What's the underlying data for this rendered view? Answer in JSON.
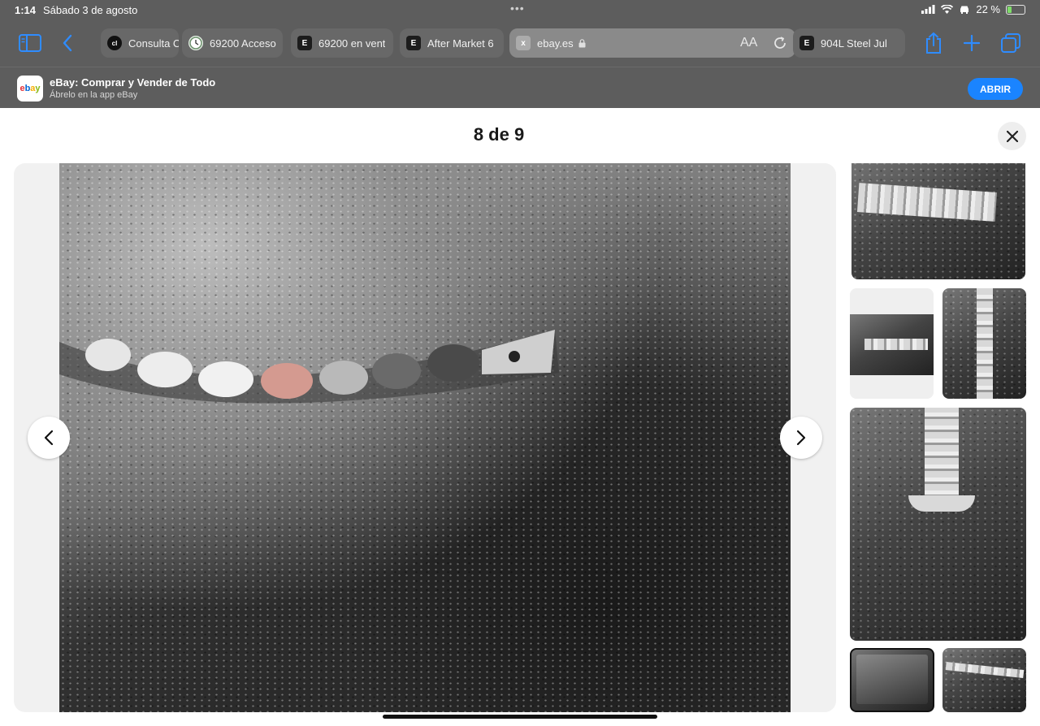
{
  "status_bar": {
    "time": "1:14",
    "date": "Sábado 3 de agosto",
    "battery_text": "22 %",
    "battery_level": 0.22,
    "icons": [
      "cellular-signal-icon",
      "wifi-icon",
      "car-icon",
      "battery-charging-icon"
    ]
  },
  "toolbar": {
    "tabs": [
      {
        "label": "Consulta C",
        "favicon": "cl"
      },
      {
        "label": "69200 Acceso",
        "favicon": "clock"
      },
      {
        "label": "69200 en vent",
        "favicon": "E"
      },
      {
        "label": "After Market 6",
        "favicon": "E"
      },
      {
        "label": "ebay.es",
        "favicon": "x",
        "active": true,
        "reader_label": "AA"
      },
      {
        "label": "904L Steel Jul",
        "favicon": "E"
      }
    ]
  },
  "banner": {
    "app_name": "eBay: Comprar y Vender de Todo",
    "subtitle": "Ábrelo en la app eBay",
    "app_icon_text": "ebay",
    "open_label": "ABRIR"
  },
  "viewer": {
    "counter": "8 de 9"
  },
  "colors": {
    "chrome": "#5d5d5d",
    "accent": "#1a84ff"
  }
}
